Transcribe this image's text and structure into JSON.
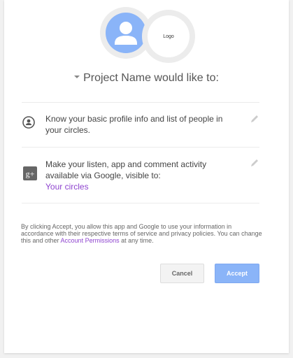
{
  "header": {
    "logo_text": "Logo",
    "title": "Project Name would like to:"
  },
  "permissions": [
    {
      "icon": "profile-icon",
      "text": "Know your basic profile info and list of people in your circles.",
      "edit_icon": "pencil-icon"
    },
    {
      "icon": "google-plus-icon",
      "text": "Make your listen, app and comment activity available via Google, visible to:",
      "visibility_link": "Your circles",
      "edit_icon": "pencil-icon"
    }
  ],
  "footer": {
    "text_before_link": "By clicking Accept, you allow this app and Google to use your information in accordance with their respective terms of service and privacy policies. You can change this and other ",
    "link_text": "Account Permissions",
    "text_after_link": " at any time."
  },
  "buttons": {
    "cancel": "Cancel",
    "accept": "Accept"
  },
  "colors": {
    "accent": "#8ab4f8",
    "link": "#8e44cf"
  }
}
